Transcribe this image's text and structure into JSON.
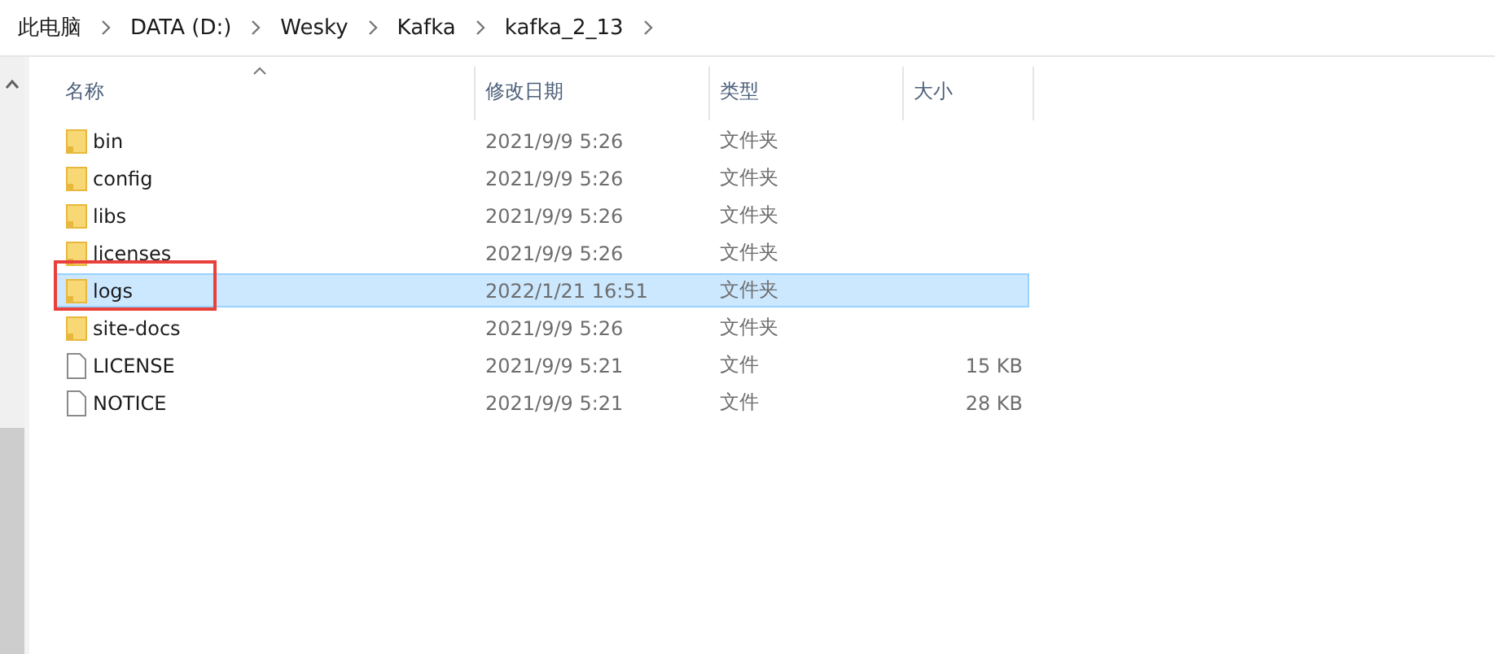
{
  "breadcrumb": [
    "此电脑",
    "DATA (D:)",
    "Wesky",
    "Kafka",
    "kafka_2_13"
  ],
  "columns": [
    {
      "label": "名称",
      "sorted": true
    },
    {
      "label": "修改日期",
      "sorted": false
    },
    {
      "label": "类型",
      "sorted": false
    },
    {
      "label": "大小",
      "sorted": false
    }
  ],
  "rows": [
    {
      "kind": "folder",
      "name": "bin",
      "date": "2021/9/9 5:26",
      "type": "文件夹",
      "selected": false,
      "annotated": false
    },
    {
      "kind": "folder",
      "name": "config",
      "date": "2021/9/9 5:26",
      "type": "文件夹",
      "selected": false,
      "annotated": false
    },
    {
      "kind": "folder",
      "name": "libs",
      "date": "2021/9/9 5:26",
      "type": "文件夹",
      "selected": false,
      "annotated": false
    },
    {
      "kind": "folder",
      "name": "licenses",
      "date": "2021/9/9 5:26",
      "type": "文件夹",
      "selected": false,
      "annotated": false
    },
    {
      "kind": "folder",
      "name": "logs",
      "date": "2022/1/21 16:51",
      "type": "文件夹",
      "selected": true,
      "annotated": true
    },
    {
      "kind": "folder",
      "name": "site-docs",
      "date": "2021/9/9 5:26",
      "type": "文件夹",
      "selected": false,
      "annotated": false
    },
    {
      "kind": "file",
      "name": "LICENSE",
      "date": "2021/9/9 5:21",
      "type": "文件",
      "size": "15 KB",
      "selected": false,
      "annotated": false
    },
    {
      "kind": "file",
      "name": "NOTICE",
      "date": "2021/9/9 5:21",
      "type": "文件",
      "size": "28 KB",
      "selected": false,
      "annotated": false
    }
  ]
}
